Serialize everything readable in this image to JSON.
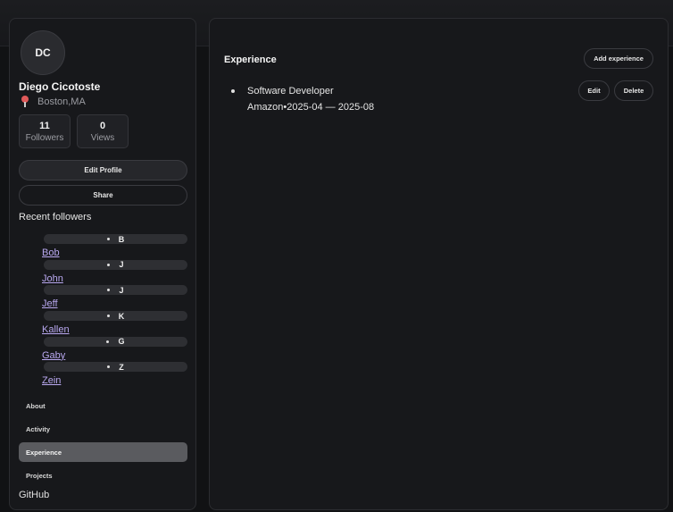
{
  "profile": {
    "initials": "DC",
    "name": "Diego Cicotoste",
    "location": "Boston,MA",
    "location_icon": "map-pin-icon",
    "stats": [
      {
        "value": "11",
        "label": "Followers"
      },
      {
        "value": "0",
        "label": "Views"
      }
    ],
    "edit_label": "Edit Profile",
    "share_label": "Share"
  },
  "recent_followers": {
    "title": "Recent followers",
    "items": [
      {
        "initial": "B",
        "name": "Bob"
      },
      {
        "initial": "J",
        "name": "John"
      },
      {
        "initial": "J",
        "name": "Jeff"
      },
      {
        "initial": "K",
        "name": "Kallen"
      },
      {
        "initial": "G",
        "name": "Gaby"
      },
      {
        "initial": "Z",
        "name": "Zein"
      }
    ]
  },
  "nav": {
    "items": [
      {
        "label": "About"
      },
      {
        "label": "Activity"
      },
      {
        "label": "Experience",
        "active": true
      },
      {
        "label": "Projects"
      }
    ],
    "github_label": "GitHub"
  },
  "experience": {
    "title": "Experience",
    "add_label": "Add experience",
    "entries": [
      {
        "role": "Software Developer",
        "company": "Amazon",
        "separator": "•",
        "start": "2025-04",
        "dash": "—",
        "end": "2025-08",
        "edit_label": "Edit",
        "delete_label": "Delete"
      }
    ]
  },
  "colors": {
    "background": "#111214",
    "panel": "#17181b",
    "link": "#b9a8f0",
    "active_nav": "#5a5b5f",
    "pin": "#e05a5a"
  }
}
